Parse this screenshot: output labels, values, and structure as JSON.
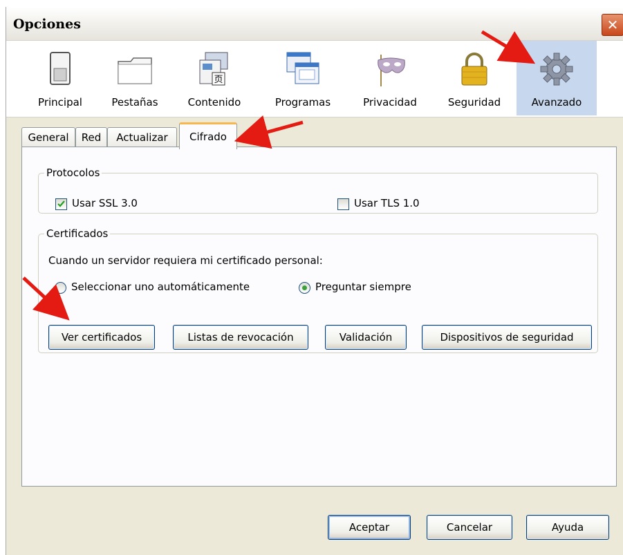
{
  "window": {
    "title": "Opciones"
  },
  "toolbar": {
    "items": [
      {
        "label": "Principal",
        "icon": "switch-icon"
      },
      {
        "label": "Pestañas",
        "icon": "folder-tab-icon"
      },
      {
        "label": "Contenido",
        "icon": "content-page-icon"
      },
      {
        "label": "Programas",
        "icon": "applications-icon"
      },
      {
        "label": "Privacidad",
        "icon": "mask-icon"
      },
      {
        "label": "Seguridad",
        "icon": "padlock-icon"
      },
      {
        "label": "Avanzado",
        "icon": "gear-icon"
      }
    ],
    "active": "Avanzado"
  },
  "subtabs": {
    "items": [
      "General",
      "Red",
      "Actualizar",
      "Cifrado"
    ],
    "active": "Cifrado"
  },
  "protocols": {
    "legend": "Protocolos",
    "ssl_label": "Usar SSL 3.0",
    "ssl_checked": true,
    "tls_label": "Usar TLS 1.0",
    "tls_checked": false
  },
  "certificates": {
    "legend": "Certificados",
    "prompt": "Cuando un servidor requiera mi certificado personal:",
    "radio_auto": "Seleccionar uno automáticamente",
    "radio_ask": "Preguntar siempre",
    "selected": "Preguntar siempre",
    "buttons": {
      "view": "Ver certificados",
      "revocation": "Listas de revocación",
      "validation": "Validación",
      "devices": "Dispositivos de seguridad"
    }
  },
  "footer": {
    "ok": "Aceptar",
    "cancel": "Cancelar",
    "help": "Ayuda"
  },
  "colors": {
    "window_bg": "#ece9d8",
    "active_toolbar": "#c6d7ee",
    "annotation_arrow": "#e31b12",
    "active_tab_accent": "#f7b64e"
  }
}
